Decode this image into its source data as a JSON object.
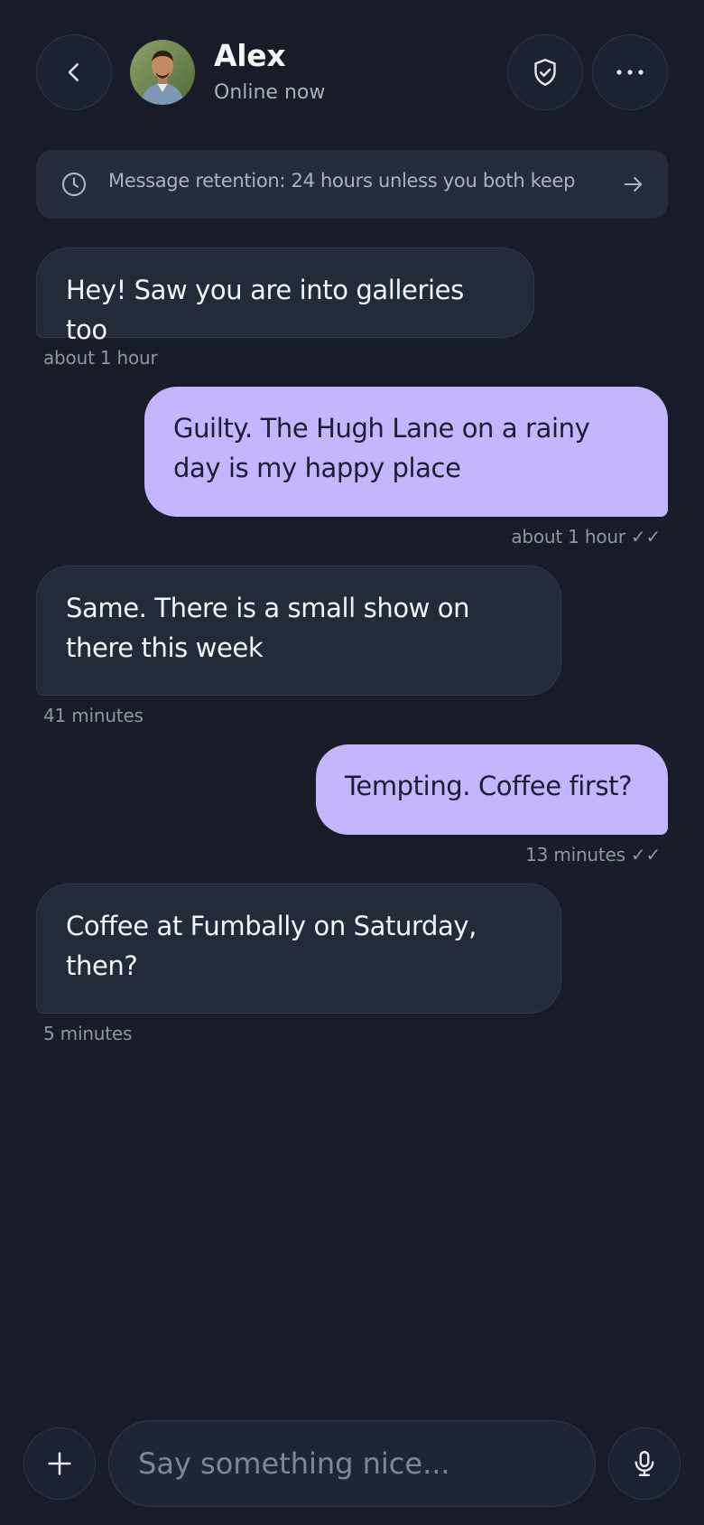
{
  "header": {
    "name": "Alex",
    "status": "Online now",
    "icons": {
      "back": "chevron-left-icon",
      "shield": "shield-check-icon",
      "more": "more-horizontal-icon"
    }
  },
  "banner": {
    "text": "Message retention: 24 hours unless you both keep",
    "icon": "clock-icon",
    "action_icon": "arrow-right-icon"
  },
  "messages": [
    {
      "direction": "in",
      "text": "Hey! Saw you are into galleries too",
      "time": "about 1 hour"
    },
    {
      "direction": "out",
      "text": "Guilty. The Hugh Lane on a rainy day is my happy place",
      "time": "about 1 hour",
      "receipt": "✓✓"
    },
    {
      "direction": "in",
      "text": "Same. There is a small show on there this week",
      "time": "41 minutes"
    },
    {
      "direction": "out",
      "text": "Tempting. Coffee first?",
      "time": "13 minutes",
      "receipt": "✓✓"
    },
    {
      "direction": "in",
      "text": "Coffee at Fumbally on Saturday, then?",
      "time": "5 minutes"
    }
  ],
  "composer": {
    "placeholder": "Say something nice...",
    "value": "",
    "icons": {
      "add": "plus-icon",
      "mic": "microphone-icon"
    }
  },
  "colors": {
    "background": "#171c28",
    "incoming_bubble": "#232a3a",
    "outgoing_bubble": "#c4b5fd",
    "muted_text": "#8d95a8"
  }
}
